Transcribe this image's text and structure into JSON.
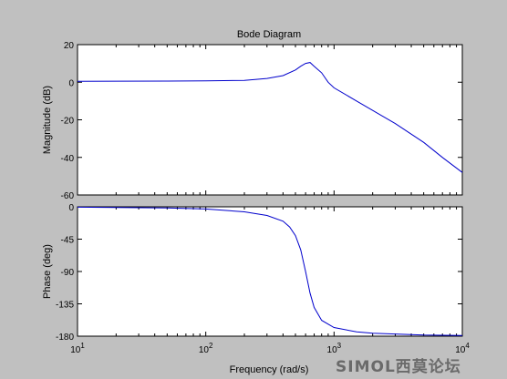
{
  "chart_data": {
    "type": "line",
    "title": "Bode Diagram",
    "xlabel": "Frequency  (rad/s)",
    "xscale": "log",
    "xlim": [
      10,
      10000
    ],
    "x_ticks": [
      {
        "base": "10",
        "exp": "1"
      },
      {
        "base": "10",
        "exp": "2"
      },
      {
        "base": "10",
        "exp": "3"
      },
      {
        "base": "10",
        "exp": "4"
      }
    ],
    "line_color": "#0000cc",
    "subplots": [
      {
        "name": "magnitude",
        "ylabel": "Magnitude (dB)",
        "ylim": [
          -60,
          20
        ],
        "y_ticks": [
          "20",
          "0",
          "-20",
          "-40",
          "-60"
        ],
        "points": [
          [
            10,
            0.5
          ],
          [
            50,
            0.6
          ],
          [
            100,
            0.7
          ],
          [
            200,
            1.0
          ],
          [
            300,
            2.0
          ],
          [
            400,
            3.5
          ],
          [
            500,
            6.5
          ],
          [
            550,
            8.5
          ],
          [
            600,
            10.0
          ],
          [
            650,
            10.5
          ],
          [
            700,
            8.5
          ],
          [
            800,
            5.0
          ],
          [
            900,
            0.0
          ],
          [
            1000,
            -3.0
          ],
          [
            1500,
            -10.0
          ],
          [
            2000,
            -15.0
          ],
          [
            3000,
            -22.0
          ],
          [
            5000,
            -32.0
          ],
          [
            7000,
            -40.0
          ],
          [
            10000,
            -48.0
          ]
        ]
      },
      {
        "name": "phase",
        "ylabel": "Phase (deg)",
        "ylim": [
          -180,
          0
        ],
        "y_ticks": [
          "0",
          "-45",
          "-90",
          "-135",
          "-180"
        ],
        "points": [
          [
            10,
            -0.5
          ],
          [
            50,
            -1.5
          ],
          [
            100,
            -3.0
          ],
          [
            200,
            -7.0
          ],
          [
            300,
            -12.0
          ],
          [
            400,
            -20.0
          ],
          [
            450,
            -28.0
          ],
          [
            500,
            -40.0
          ],
          [
            550,
            -60.0
          ],
          [
            600,
            -90.0
          ],
          [
            650,
            -120.0
          ],
          [
            700,
            -140.0
          ],
          [
            800,
            -158.0
          ],
          [
            1000,
            -168.0
          ],
          [
            1500,
            -174.0
          ],
          [
            2000,
            -176.0
          ],
          [
            5000,
            -178.5
          ],
          [
            10000,
            -179.0
          ]
        ]
      }
    ]
  },
  "watermark": "SIMOL西莫论坛"
}
